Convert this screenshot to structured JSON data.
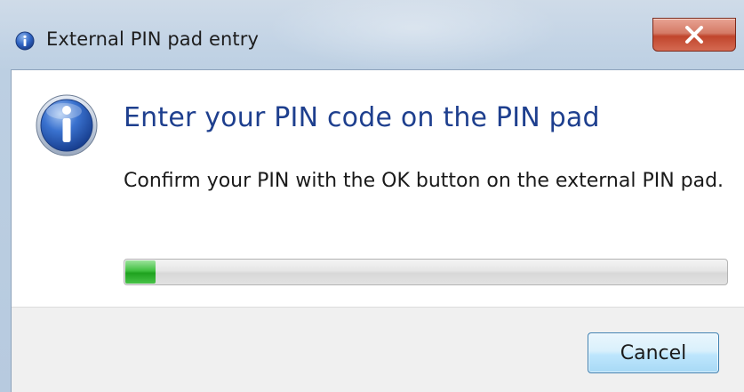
{
  "window": {
    "title": "External PIN pad entry",
    "title_icon": "info-icon",
    "close_icon": "close-icon"
  },
  "dialog": {
    "icon": "info-icon",
    "main_instruction": "Enter your PIN code on the PIN pad",
    "content": "Confirm your PIN with the OK button on the external PIN pad.",
    "progress_fraction": 0.05
  },
  "footer": {
    "cancel_label": "Cancel"
  },
  "colors": {
    "main_instruction": "#1e3f8e",
    "progress_fill": "#2fb02f",
    "close_button": "#c7503a",
    "cancel_button_border": "#3c7fb1"
  }
}
